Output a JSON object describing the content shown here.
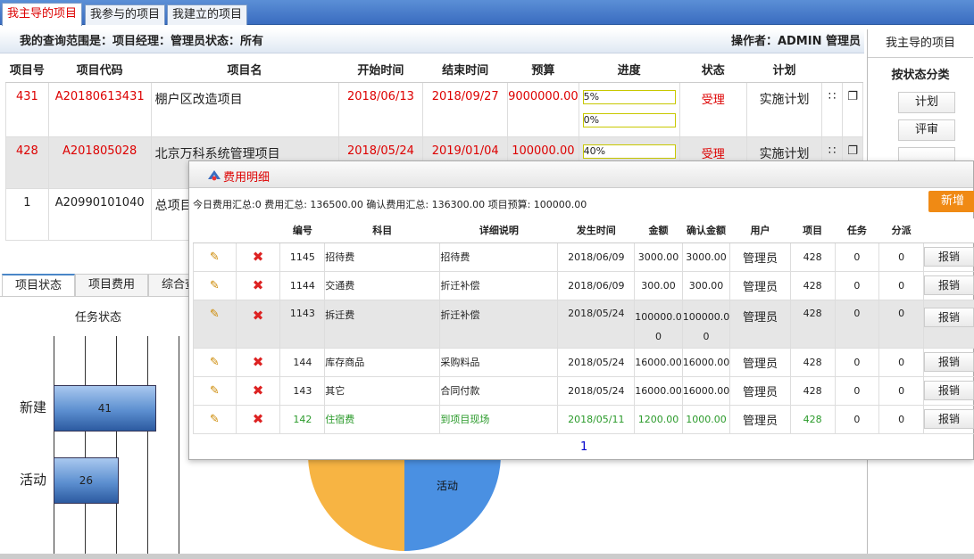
{
  "top_tabs": [
    "我主导的项目",
    "我参与的项目",
    "我建立的项目"
  ],
  "query": {
    "scope": "我的查询范围是：项目经理：管理员状态：所有",
    "operator": "操作者：ADMIN 管理员"
  },
  "main_table": {
    "headers": [
      "项目号",
      "项目代码",
      "项目名",
      "开始时间",
      "结束时间",
      "预算",
      "进度",
      "状态",
      "计划"
    ],
    "rows": [
      {
        "id": "431",
        "code": "A20180613431",
        "name": "棚户区改造项目",
        "start": "2018/06/13",
        "end": "2018/09/27",
        "budget": "9000000.00",
        "progress": [
          "5%",
          "0%"
        ],
        "progress_values": [
          5,
          0
        ],
        "status": "受理",
        "plan": "实施计划"
      },
      {
        "id": "428",
        "code": "A201805028",
        "name": "北京万科系统管理项目",
        "start": "2018/05/24",
        "end": "2019/01/04",
        "budget": "100000.00",
        "progress": [
          "40%"
        ],
        "progress_values": [
          40
        ],
        "status": "受理",
        "plan": "实施计划"
      },
      {
        "id": "1",
        "code": "A20990101040",
        "name": "总项目"
      }
    ]
  },
  "right_panel": {
    "title": "我主导的项目",
    "section": "按状态分类",
    "buttons": [
      "计划",
      "评审"
    ]
  },
  "lower_tabs": [
    "项目状态",
    "项目费用",
    "综合查"
  ],
  "bar_chart_title": "任务状态",
  "chart_data": {
    "type": "bar",
    "title": "任务状态",
    "categories": [
      "新建",
      "活动"
    ],
    "values": [
      41,
      26
    ],
    "orientation": "horizontal",
    "xlim": [
      0,
      50
    ]
  },
  "pie_label": "活动",
  "modal": {
    "title": "费用明细",
    "summary": "今日费用汇总:0 费用汇总: 136500.00 确认费用汇总: 136300.00 项目预算: 100000.00",
    "add_label": "新增",
    "headers": [
      "",
      "",
      "编号",
      "科目",
      "详细说明",
      "发生时间",
      "金额",
      "确认金额",
      "用户",
      "项目",
      "任务",
      "分派",
      ""
    ],
    "rows": [
      {
        "no": "1145",
        "subject": "招待费",
        "desc": "招待费",
        "date": "2018/06/09",
        "amount": "3000.00",
        "confirmed": "3000.00",
        "user": "管理员",
        "project": "428",
        "task": "0",
        "assign": "0",
        "action": "报销"
      },
      {
        "no": "1144",
        "subject": "交通费",
        "desc": "折迁补偿",
        "date": "2018/06/09",
        "amount": "300.00",
        "confirmed": "300.00",
        "user": "管理员",
        "project": "428",
        "task": "0",
        "assign": "0",
        "action": "报销"
      },
      {
        "no": "1143",
        "subject": "拆迁费",
        "desc": "折迁补偿",
        "date": "2018/05/24",
        "amount": "100000.00",
        "confirmed": "100000.00",
        "user": "管理员",
        "project": "428",
        "task": "0",
        "assign": "0",
        "action": "报销"
      },
      {
        "no": "144",
        "subject": "库存商品",
        "desc": "采购料品",
        "date": "2018/05/24",
        "amount": "16000.00",
        "confirmed": "16000.00",
        "user": "管理员",
        "project": "428",
        "task": "0",
        "assign": "0",
        "action": "报销"
      },
      {
        "no": "143",
        "subject": "其它",
        "desc": "合同付款",
        "date": "2018/05/24",
        "amount": "16000.00",
        "confirmed": "16000.00",
        "user": "管理员",
        "project": "428",
        "task": "0",
        "assign": "0",
        "action": "报销"
      },
      {
        "no": "142",
        "subject": "住宿费",
        "desc": "到项目现场",
        "date": "2018/05/11",
        "amount": "1200.00",
        "confirmed": "1000.00",
        "user": "管理员",
        "project": "428",
        "task": "0",
        "assign": "0",
        "action": "报销"
      }
    ],
    "page": "1"
  }
}
